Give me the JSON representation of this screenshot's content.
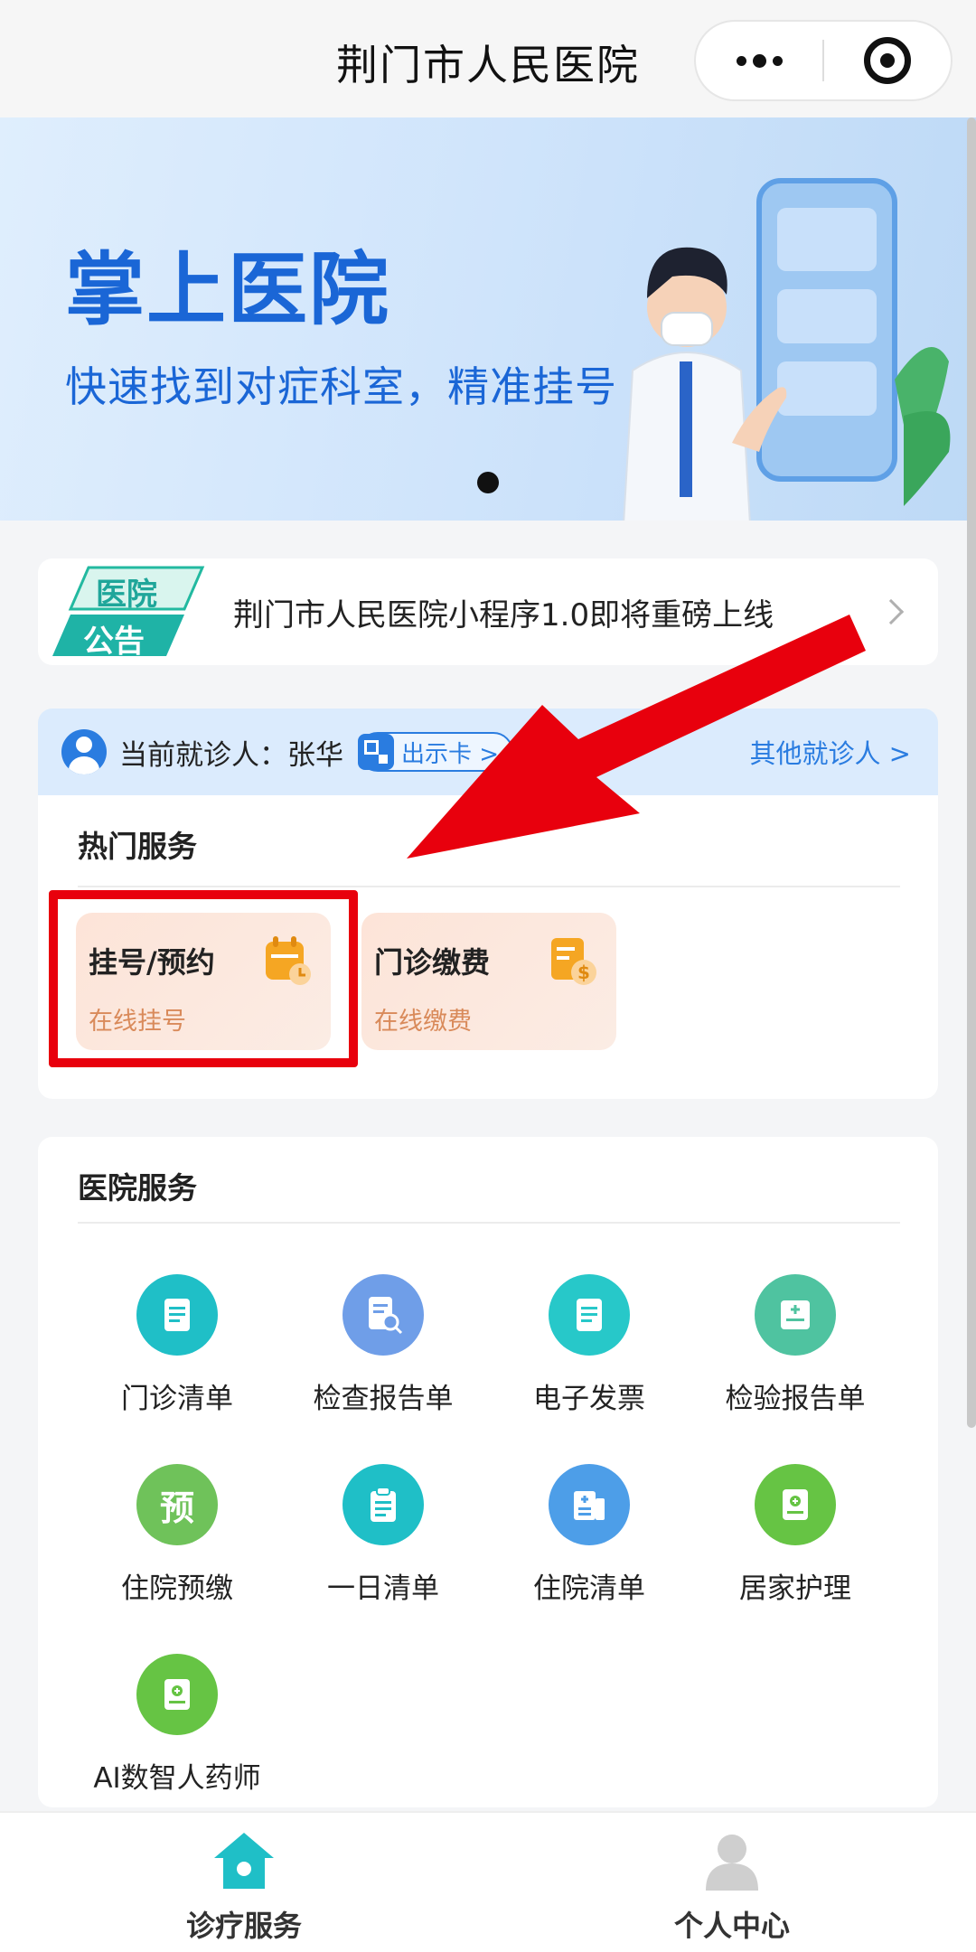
{
  "header": {
    "title": "荆门市人民医院"
  },
  "banner": {
    "title": "掌上医院",
    "subtitle": "快速找到对症科室，精准挂号"
  },
  "notice": {
    "badge_line1": "医院",
    "badge_line2": "公告",
    "text": "荆门市人民医院小程序1.0即将重磅上线"
  },
  "patient": {
    "label": "当前就诊人：张华",
    "card_button": "出示卡 >",
    "other_link": "其他就诊人 >"
  },
  "hot_services": {
    "title": "热门服务",
    "items": [
      {
        "title": "挂号/预约",
        "subtitle": "在线挂号",
        "icon": "calendar-icon"
      },
      {
        "title": "门诊缴费",
        "subtitle": "在线缴费",
        "icon": "payment-icon"
      }
    ]
  },
  "hospital_services": {
    "title": "医院服务",
    "items": [
      {
        "label": "门诊清单",
        "icon": "document-icon"
      },
      {
        "label": "检查报告单",
        "icon": "report-search-icon"
      },
      {
        "label": "电子发票",
        "icon": "invoice-icon"
      },
      {
        "label": "检验报告单",
        "icon": "lab-report-icon"
      },
      {
        "label": "住院预缴",
        "icon": "prepay-icon",
        "glyph": "预"
      },
      {
        "label": "一日清单",
        "icon": "clipboard-icon"
      },
      {
        "label": "住院清单",
        "icon": "inpatient-list-icon"
      },
      {
        "label": "居家护理",
        "icon": "home-care-icon"
      },
      {
        "label": "AI数智人药师",
        "icon": "ai-pharmacist-icon"
      }
    ]
  },
  "tabbar": {
    "tabs": [
      {
        "label": "诊疗服务",
        "active": true
      },
      {
        "label": "个人中心",
        "active": false
      }
    ]
  },
  "colors": {
    "accent": "#2a7ce0",
    "active_tab": "#1fbfc7",
    "highlight": "#e8000d"
  }
}
